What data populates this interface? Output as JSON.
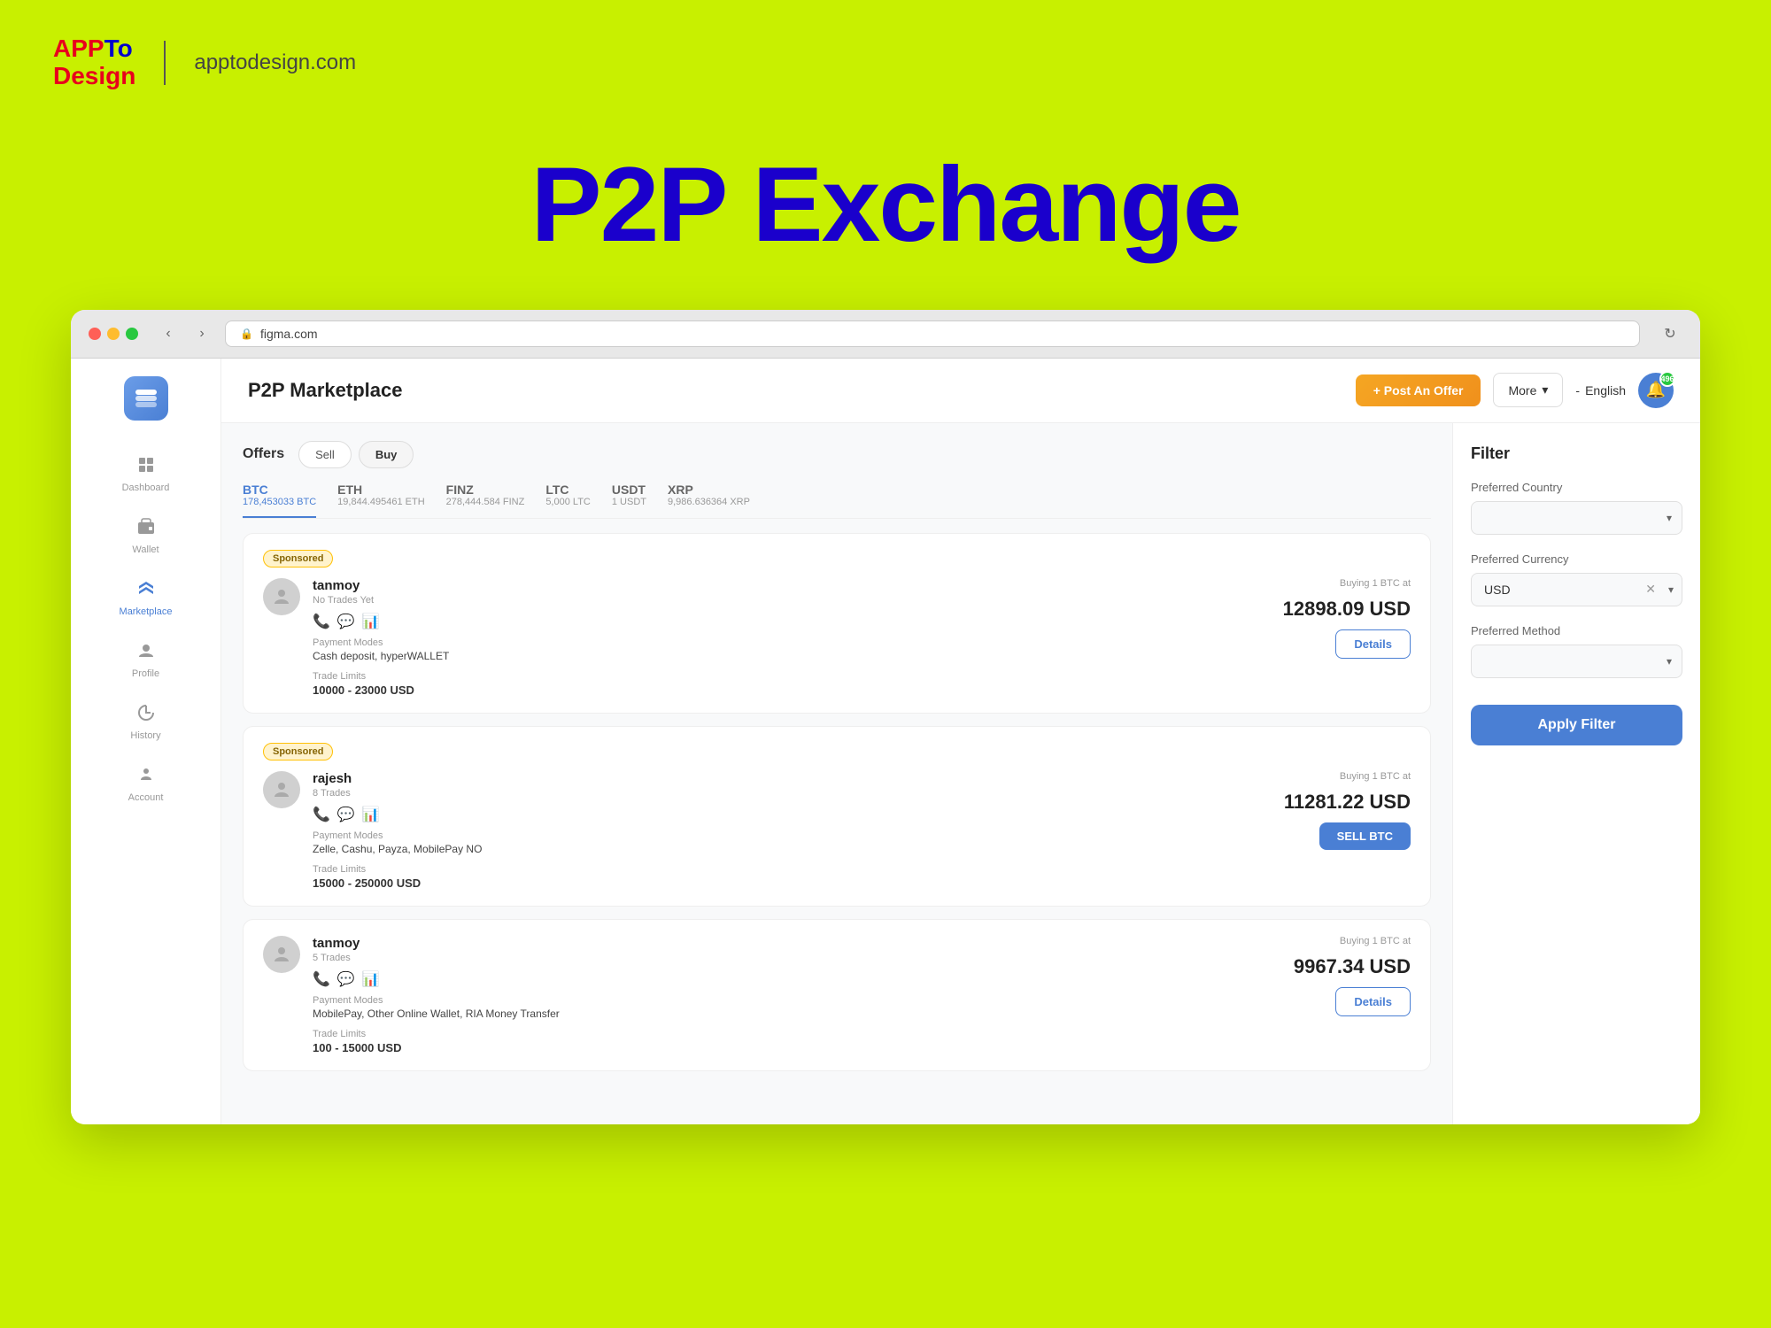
{
  "branding": {
    "logo_app": "APP",
    "logo_to": "To",
    "logo_design": "Design",
    "divider": "|",
    "url": "apptodesign.com"
  },
  "main_title": "P2P Exchange",
  "browser": {
    "url": "figma.com",
    "reload_icon": "↻",
    "back_icon": "‹",
    "forward_icon": "›"
  },
  "app": {
    "title": "P2P Marketplace",
    "header": {
      "post_offer_label": "+ Post An Offer",
      "more_label": "More",
      "language_label": "English",
      "notification_count": "496"
    },
    "sidebar": {
      "items": [
        {
          "id": "dashboard",
          "label": "Dashboard",
          "icon": "▦"
        },
        {
          "id": "wallet",
          "label": "Wallet",
          "icon": "⊟"
        },
        {
          "id": "marketplace",
          "label": "Marketplace",
          "icon": "⇅"
        },
        {
          "id": "profile",
          "label": "Profile",
          "icon": "⊙"
        },
        {
          "id": "history",
          "label": "History",
          "icon": "◷"
        },
        {
          "id": "account",
          "label": "Account",
          "icon": "☺"
        }
      ]
    },
    "tabs": {
      "offers_label": "Offers",
      "sell_label": "Sell",
      "buy_label": "Buy"
    },
    "crypto_tabs": [
      {
        "id": "btc",
        "name": "BTC",
        "amount": "178,453033 BTC",
        "active": true
      },
      {
        "id": "eth",
        "name": "ETH",
        "amount": "19,844.495461 ETH",
        "active": false
      },
      {
        "id": "finz",
        "name": "FINZ",
        "amount": "278,444.584 FINZ",
        "active": false
      },
      {
        "id": "ltc",
        "name": "LTC",
        "amount": "5,000 LTC",
        "active": false
      },
      {
        "id": "usdt",
        "name": "USDT",
        "amount": "1 USDT",
        "active": false
      },
      {
        "id": "xrp",
        "name": "XRP",
        "amount": "9,986.636364 XRP",
        "active": false
      }
    ],
    "offers": [
      {
        "id": "offer-1",
        "sponsored": true,
        "sponsored_label": "Sponsored",
        "username": "tanmoy",
        "trades": "No Trades Yet",
        "payment_modes_label": "Payment Modes",
        "payment_modes": "Cash deposit, hyperWALLET",
        "trade_limits_label": "Trade Limits",
        "trade_limits": "10000 - 23000 USD",
        "buying_label": "Buying 1 BTC at",
        "price": "12898.09 USD",
        "action_label": "Details",
        "action_type": "details"
      },
      {
        "id": "offer-2",
        "sponsored": true,
        "sponsored_label": "Sponsored",
        "username": "rajesh",
        "trades": "8 Trades",
        "payment_modes_label": "Payment Modes",
        "payment_modes": "Zelle, Cashu, Payza, MobilePay NO",
        "trade_limits_label": "Trade Limits",
        "trade_limits": "15000 - 250000 USD",
        "buying_label": "Buying 1 BTC at",
        "price": "11281.22 USD",
        "action_label": "SELL BTC",
        "action_type": "sell"
      },
      {
        "id": "offer-3",
        "sponsored": false,
        "username": "tanmoy",
        "trades": "5 Trades",
        "payment_modes_label": "Payment Modes",
        "payment_modes": "MobilePay, Other Online Wallet, RIA Money Transfer",
        "trade_limits_label": "Trade Limits",
        "trade_limits": "100 - 15000 USD",
        "buying_label": "Buying 1 BTC at",
        "price": "9967.34 USD",
        "action_label": "Details",
        "action_type": "details"
      }
    ],
    "filter": {
      "title": "Filter",
      "country_label": "Preferred Country",
      "country_placeholder": "",
      "currency_label": "Preferred Currency",
      "currency_value": "USD",
      "method_label": "Preferred Method",
      "method_placeholder": "",
      "apply_label": "Apply Filter"
    }
  }
}
